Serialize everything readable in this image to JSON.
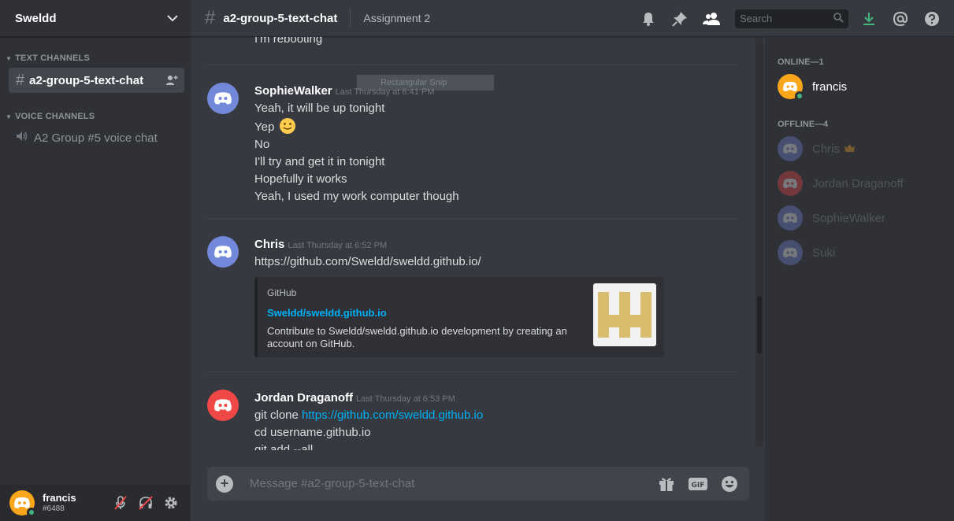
{
  "server": {
    "name": "Sweldd"
  },
  "categories": {
    "text": "TEXT CHANNELS",
    "voice": "VOICE CHANNELS"
  },
  "channels": {
    "text": [
      {
        "name": "a2-group-5-text-chat"
      }
    ],
    "voice": [
      {
        "name": "A2 Group #5 voice chat"
      }
    ]
  },
  "user": {
    "name": "francis",
    "tag": "#6488"
  },
  "header": {
    "channel": "a2-group-5-text-chat",
    "topic": "Assignment 2",
    "search_placeholder": "Search"
  },
  "chat": {
    "previous_line": "I'm rebooting",
    "snip_overlay": "Rectangular Snip",
    "messages": [
      {
        "author": "SophieWalker",
        "timestamp": "Last Thursday at 6:41 PM",
        "lines": [
          "Yeah, it will be up tonight",
          "Yep",
          "No",
          "I'll try and get it in tonight",
          "Hopefully it works",
          "Yeah, I used my work computer though"
        ]
      },
      {
        "author": "Chris",
        "timestamp": "Last Thursday at 6:52 PM",
        "link": "https://github.com/Sweldd/sweldd.github.io/",
        "embed": {
          "provider": "GitHub",
          "title": "Sweldd/sweldd.github.io",
          "description": "Contribute to Sweldd/sweldd.github.io development by creating an account on GitHub."
        }
      },
      {
        "author": "Jordan Draganoff",
        "timestamp": "Last Thursday at 6:53 PM",
        "line1_prefix": "git clone ",
        "line1_link": "https://github.com/sweldd.github.io",
        "line2": "cd username.github.io",
        "line3": "git add --all"
      }
    ]
  },
  "composer": {
    "placeholder": "Message #a2-group-5-text-chat"
  },
  "members": {
    "online_header": "ONLINE—1",
    "online": [
      {
        "name": "francis"
      }
    ],
    "offline_header": "OFFLINE—4",
    "offline": [
      {
        "name": "Chris"
      },
      {
        "name": "Jordan Draganoff"
      },
      {
        "name": "SophieWalker"
      },
      {
        "name": "Suki"
      }
    ]
  },
  "colors": {
    "accent": "#7289da",
    "link": "#00b0f4",
    "online": "#43b581",
    "avatar_orange": "#faa61a",
    "avatar_red": "#f04747",
    "avatar_blurple": "#7289da",
    "download_green": "#43b581"
  },
  "icons": [
    "chevron-down-icon",
    "hash-icon",
    "add-member-icon",
    "speaker-icon",
    "bell-icon",
    "pin-icon",
    "members-icon",
    "search-icon",
    "download-icon",
    "mention-icon",
    "help-icon",
    "mute-icon",
    "deafen-icon",
    "gear-icon",
    "plus-icon",
    "gift-icon",
    "gif-icon",
    "emoji-icon",
    "crown-icon",
    "discord-logo"
  ]
}
